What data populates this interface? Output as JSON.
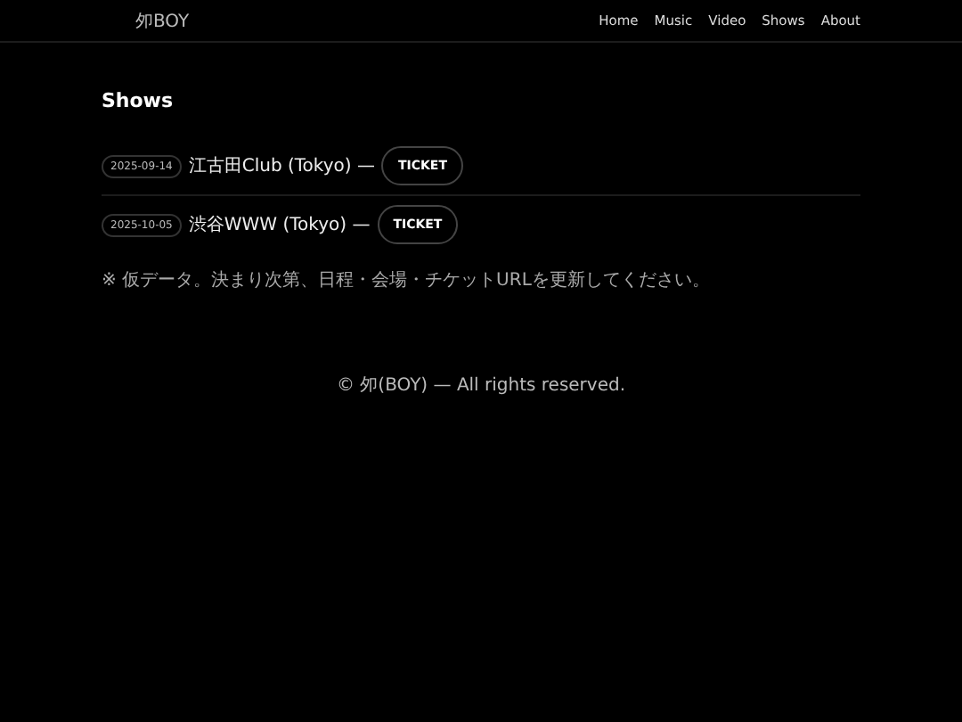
{
  "header": {
    "logo": "夘BOY",
    "nav": [
      {
        "label": "Home"
      },
      {
        "label": "Music"
      },
      {
        "label": "Video"
      },
      {
        "label": "Shows"
      },
      {
        "label": "About"
      }
    ]
  },
  "section": {
    "title": "Shows",
    "shows": [
      {
        "date": "2025-09-14",
        "venue": "江古田Club (Tokyo) —",
        "ticket": "TICKET"
      },
      {
        "date": "2025-10-05",
        "venue": "渋谷WWW (Tokyo) —",
        "ticket": "TICKET"
      }
    ],
    "note": "※ 仮データ。決まり次第、日程・会場・チケットURLを更新してください。"
  },
  "footer": "© 夘(BOY) — All rights reserved."
}
